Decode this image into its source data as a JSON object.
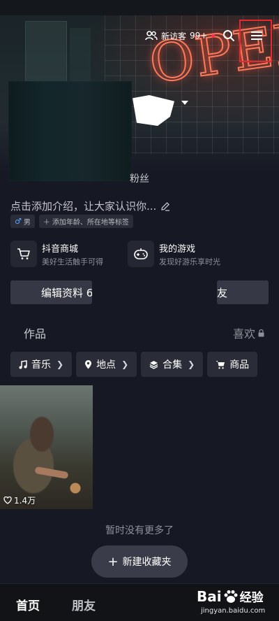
{
  "header": {
    "visitors_label": "新访客",
    "visitors_count": "99+"
  },
  "profile": {
    "fans_label": "粉丝",
    "bio": "点击添加介绍，让大家认识你...",
    "gender_tag": "男",
    "add_tag": "添加年龄、所在地等标签"
  },
  "services": [
    {
      "title": "抖音商城",
      "subtitle": "美好生活触手可得",
      "icon": "cart-icon"
    },
    {
      "title": "我的游戏",
      "subtitle": "发现好游乐享时光",
      "icon": "gamepad-icon"
    }
  ],
  "buttons": {
    "edit_profile": "编辑资料 6",
    "add_friend": "友"
  },
  "tabs": {
    "works": "作品",
    "likes": "喜欢"
  },
  "chips": [
    {
      "label": "音乐",
      "icon": "music-icon"
    },
    {
      "label": "地点",
      "icon": "location-pin-icon"
    },
    {
      "label": "合集",
      "icon": "layers-icon"
    },
    {
      "label": "商品",
      "icon": "cart-icon"
    }
  ],
  "video": {
    "likes": "1.4万"
  },
  "footer": {
    "no_more": "暂时没有更多了",
    "new_folder": "新建收藏夹"
  },
  "nav": {
    "home": "首页",
    "friends": "朋友"
  },
  "watermark": {
    "brand": "Bai",
    "brand2": "经验",
    "url": "jingyan.baidu.com"
  },
  "colors": {
    "background": "#161823",
    "surface": "#2a2c37",
    "highlight_box": "#e8262c",
    "accent": "#fe2c55"
  }
}
